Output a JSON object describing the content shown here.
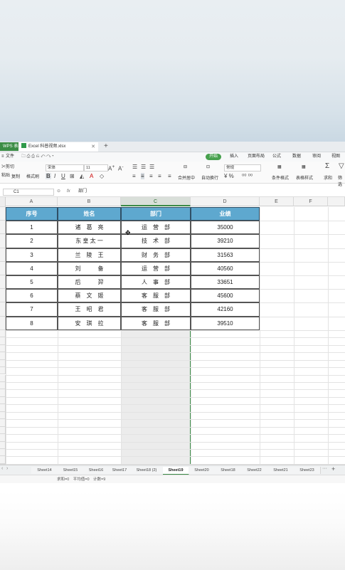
{
  "window": {
    "wps_tab": "WPS 表格",
    "doc_tab": "Excel 科普视频.xlsx"
  },
  "menu": {
    "file": "文件",
    "start": "开始",
    "insert": "插入",
    "page_layout": "页面布局",
    "formula": "公式",
    "data": "数据",
    "review": "审阅",
    "view": "视图"
  },
  "ribbon": {
    "cut": "剪切",
    "paste": "粘贴",
    "copy": "复制",
    "format_painter": "格式刷",
    "font_name": "宋体",
    "font_size": "11",
    "merge_center": "合并居中",
    "wrap_text": "自动换行",
    "number_format": "常规",
    "conditional_format": "条件格式",
    "table_style": "表格样式",
    "sum": "求和",
    "filter": "筛选"
  },
  "formula_bar": {
    "name_box": "C1",
    "fx": "fx",
    "content": "部门"
  },
  "columns": [
    "A",
    "B",
    "C",
    "D",
    "E",
    "F"
  ],
  "table": {
    "headers": [
      "序号",
      "姓名",
      "部门",
      "业绩"
    ],
    "rows": [
      [
        "1",
        "诸　葛　亮",
        "运　营　部",
        "35000"
      ],
      [
        "2",
        "东 皇 太 一",
        "技　术　部",
        "39210"
      ],
      [
        "3",
        "兰　陵　王",
        "财　务　部",
        "31563"
      ],
      [
        "4",
        "刘　　　备",
        "运　营　部",
        "40560"
      ],
      [
        "5",
        "后　　　羿",
        "人　事　部",
        "33651"
      ],
      [
        "6",
        "蔡　文　姬",
        "客　服　部",
        "45600"
      ],
      [
        "7",
        "王　昭　君",
        "客　服　部",
        "42160"
      ],
      [
        "8",
        "安　琪　拉",
        "客　服　部",
        "39510"
      ]
    ]
  },
  "sheets": [
    "Sheet14",
    "Sheet15",
    "Sheet16",
    "Sheet17",
    "Sheet18 (2)",
    "Sheet19",
    "Sheet20",
    "Sheet18",
    "Sheet22",
    "Sheet21",
    "Sheet23"
  ],
  "active_sheet": "Sheet19",
  "status": "求和=0　平均值=0　计数=9"
}
